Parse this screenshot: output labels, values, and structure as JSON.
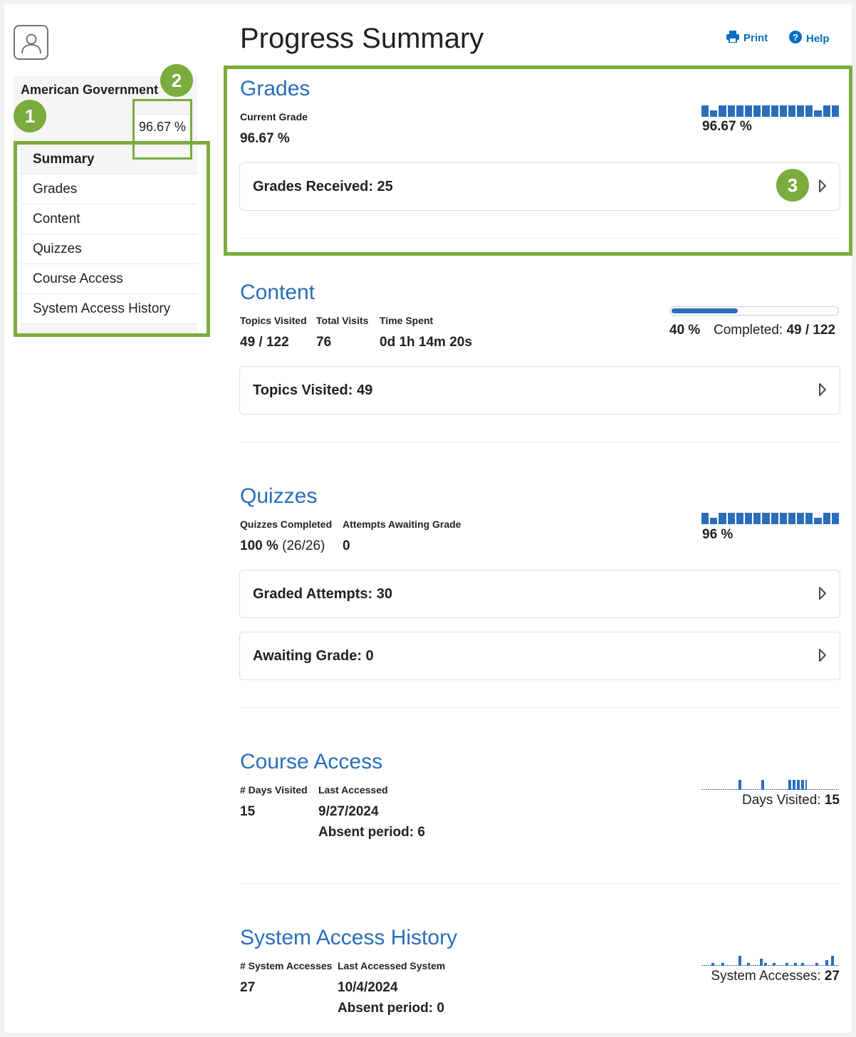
{
  "header": {
    "title": "Progress Summary",
    "print_label": "Print",
    "help_label": "Help"
  },
  "sidebar": {
    "course_name": "American Government",
    "course_grade": "96.67 %",
    "items": [
      "Summary",
      "Grades",
      "Content",
      "Quizzes",
      "Course Access",
      "System Access History"
    ],
    "active_item": "Summary"
  },
  "callouts": [
    "1",
    "2",
    "3"
  ],
  "grades": {
    "title": "Grades",
    "current_label": "Current Grade",
    "current_value": "96.67 %",
    "chart_value": "96.67 %",
    "card": "Grades Received: 25"
  },
  "content": {
    "title": "Content",
    "topics_label": "Topics Visited",
    "topics_value": "49 / 122",
    "visits_label": "Total Visits",
    "visits_value": "76",
    "time_label": "Time Spent",
    "time_value": "0d 1h 14m 20s",
    "progress_pct": "40 %",
    "progress_fraction": 0.4,
    "completed_label": "Completed:",
    "completed_value": "49 / 122",
    "card": "Topics Visited: 49"
  },
  "quizzes": {
    "title": "Quizzes",
    "completed_label": "Quizzes Completed",
    "completed_pct": "100 %",
    "completed_count": "(26/26)",
    "awaiting_label": "Attempts Awaiting Grade",
    "awaiting_value": "0",
    "chart_value": "96 %",
    "card_graded": "Graded Attempts: 30",
    "card_awaiting": "Awaiting Grade: 0"
  },
  "course_access": {
    "title": "Course Access",
    "days_label": "# Days Visited",
    "days_value": "15",
    "last_label": "Last Accessed",
    "last_value": "9/27/2024",
    "absent": "Absent period: 6",
    "chart_label": "Days Visited:",
    "chart_value": "15"
  },
  "system_access": {
    "title": "System Access History",
    "count_label": "# System Accesses",
    "count_value": "27",
    "last_label": "Last Accessed System",
    "last_value": "10/4/2024",
    "absent": "Absent period: 0",
    "chart_label": "System Accesses:",
    "chart_value": "27"
  },
  "colors": {
    "accent": "#2a6ebb",
    "callout": "#7cab3e",
    "link": "#006fbf"
  },
  "icons": [
    "avatar-icon",
    "print-icon",
    "help-icon",
    "chevron-right-icon"
  ]
}
